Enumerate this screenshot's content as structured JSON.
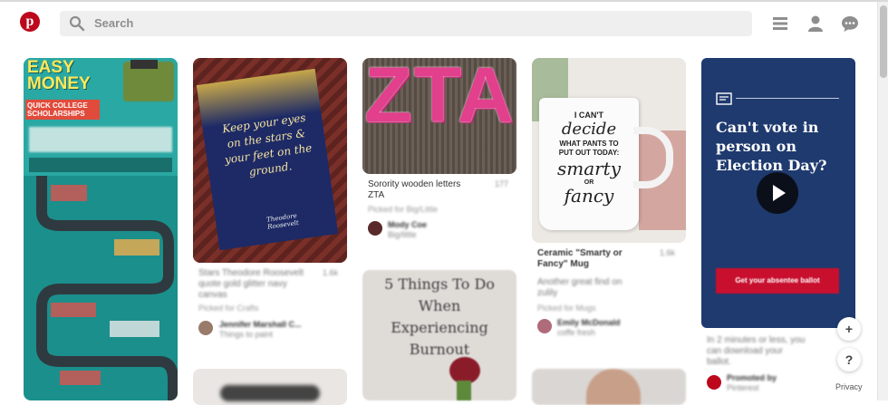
{
  "header": {
    "logo_glyph": "p",
    "search_placeholder": "Search",
    "icons": [
      "pinterest-logo-icon",
      "search-icon",
      "menu-icon",
      "profile-icon",
      "messages-icon"
    ]
  },
  "pins": {
    "p1": {
      "title_big": "EASY MONEY",
      "subtitle": "QUICK COLLEGE SCHOLARSHIPS"
    },
    "p2": {
      "quote": "Keep your eyes on the stars & your feet on the ground.",
      "signature": "Theodore Roosevelt",
      "desc": "Stars Theodore Roosevelt quote gold glitter navy canvas",
      "saves": "1.6k",
      "picked": "Picked for Crafts",
      "user": "Jennifer Marshall C...",
      "board": "Things to paint"
    },
    "p3": {
      "letters": "ZTA",
      "desc": "Sorority wooden letters ZTA",
      "saves": "177",
      "picked": "Picked for Big/Little",
      "user": "Mody Coe",
      "board": "Big/little"
    },
    "p4": {
      "text1": "5 Things To Do",
      "text2": "When",
      "text3": "Experiencing",
      "text4": "Burnout"
    },
    "p5": {
      "mug_l1": "I CAN'T",
      "mug_l2": "decide",
      "mug_l3": "WHAT PANTS TO",
      "mug_l4": "PUT OUT TODAY:",
      "mug_l5": "smarty",
      "mug_l6": "OR",
      "mug_l7": "fancy",
      "desc": "Ceramic \"Smarty or Fancy\" Mug",
      "saves": "1.6k",
      "sub": "Another great find on zulily",
      "picked": "Picked for Mugs",
      "user": "Emily McDonald",
      "board": "coffe fresh"
    },
    "p6": {
      "headline": "Can't vote in person on Election Day?",
      "cta": "Get your absentee ballot",
      "desc": "In 2 minutes or less, you can download your ballot.",
      "promoted": "Promoted by",
      "promoter": "Pinterest"
    }
  },
  "side_buttons": {
    "add": "+",
    "help": "?"
  },
  "footer": {
    "privacy": "Privacy"
  },
  "colors": {
    "brand": "#bd081c",
    "ad_bg": "#1f3a6e",
    "cta_bg": "#c8102e",
    "zta_pink": "#e23f8c"
  }
}
